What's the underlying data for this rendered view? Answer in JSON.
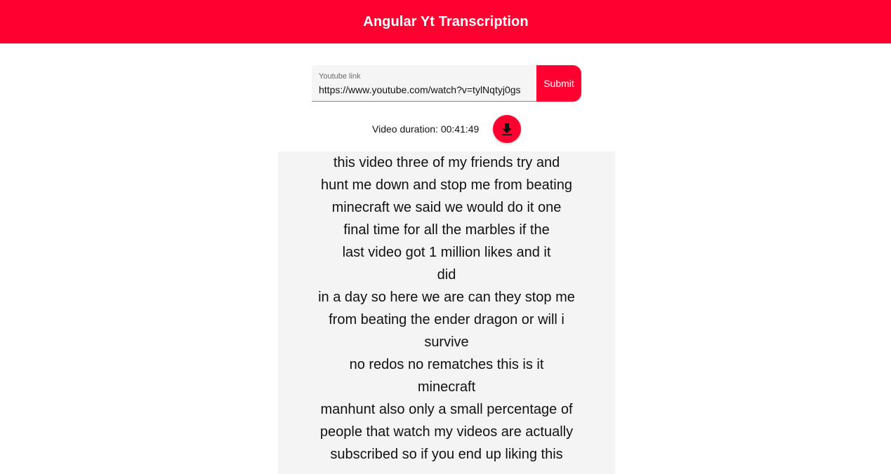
{
  "toolbar": {
    "title": "Angular Yt Transcription",
    "color": "#ff0030"
  },
  "form": {
    "label": "Youtube link",
    "value": "https://www.youtube.com/watch?v=tylNqtyj0gs",
    "submit_label": "Submit"
  },
  "video": {
    "duration_text": "Video duration: 00:41:49",
    "download_icon": "download-icon"
  },
  "transcript": {
    "lines": [
      "this video three of my friends try and",
      "hunt me down and stop me from beating",
      "minecraft we said we would do it one",
      "final time for all the marbles if the",
      "last video got 1 million likes and it",
      "did",
      "in a day so here we are can they stop me",
      "from beating the ender dragon or will i",
      "survive",
      "no redos no rematches this is it",
      "minecraft",
      "manhunt also only a small percentage of",
      "people that watch my videos are actually",
      "subscribed so if you end up liking this"
    ]
  }
}
